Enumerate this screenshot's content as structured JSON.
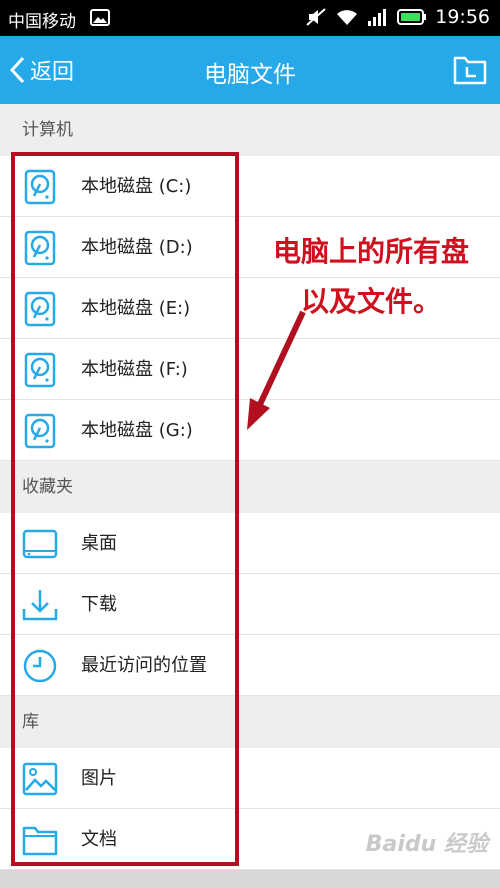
{
  "status_bar": {
    "carrier": "中国移动",
    "time": "19:56"
  },
  "header": {
    "back_label": "返回",
    "title": "电脑文件"
  },
  "sections": [
    {
      "title": "计算机",
      "items": [
        {
          "label": "本地磁盘 (C:)",
          "icon": "drive-icon"
        },
        {
          "label": "本地磁盘 (D:)",
          "icon": "drive-icon"
        },
        {
          "label": "本地磁盘 (E:)",
          "icon": "drive-icon"
        },
        {
          "label": "本地磁盘 (F:)",
          "icon": "drive-icon"
        },
        {
          "label": "本地磁盘 (G:)",
          "icon": "drive-icon"
        }
      ]
    },
    {
      "title": "收藏夹",
      "items": [
        {
          "label": "桌面",
          "icon": "desktop-icon"
        },
        {
          "label": "下载",
          "icon": "download-icon"
        },
        {
          "label": "最近访问的位置",
          "icon": "clock-icon"
        }
      ]
    },
    {
      "title": "库",
      "items": [
        {
          "label": "图片",
          "icon": "picture-icon"
        },
        {
          "label": "文档",
          "icon": "folder-icon"
        }
      ]
    }
  ],
  "annotation": {
    "line1": "电脑上的所有盘",
    "line2": "以及文件。"
  },
  "watermark": "Baidu 经验",
  "colors": {
    "header": "#26a9e8",
    "icon": "#26a9e8",
    "annotation": "#d0101e",
    "section_bg": "#eeeeee"
  }
}
